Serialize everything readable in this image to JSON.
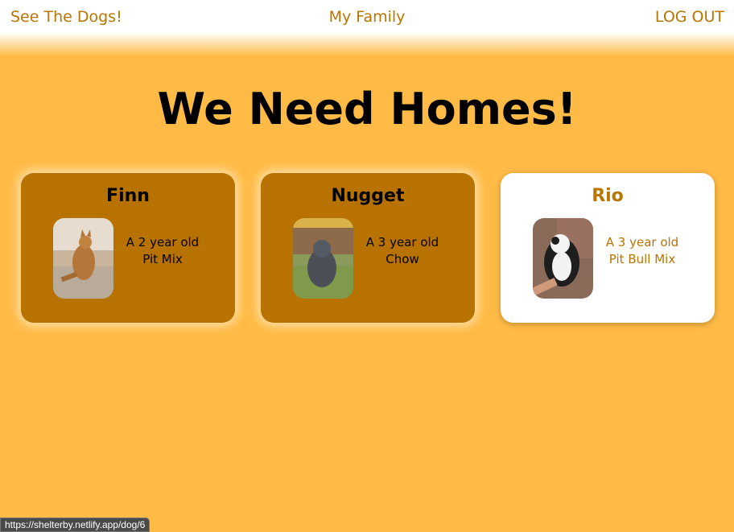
{
  "nav": {
    "left_link": "See The Dogs!",
    "center_link": "My Family",
    "right_link": "LOG OUT"
  },
  "main": {
    "title": "We Need Homes!"
  },
  "dogs": [
    {
      "name": "Finn",
      "line1": "A 2 year old",
      "line2": "Pit Mix"
    },
    {
      "name": "Nugget",
      "line1": "A 3 year old",
      "line2": "Chow"
    },
    {
      "name": "Rio",
      "line1": "A 3 year old",
      "line2": "Pit Bull Mix"
    }
  ],
  "status": {
    "url": "https://shelterby.netlify.app/dog/6"
  },
  "colors": {
    "background": "#ffbb45",
    "accent": "#b87500",
    "card": "#b87200",
    "card_active": "#ffffff"
  }
}
